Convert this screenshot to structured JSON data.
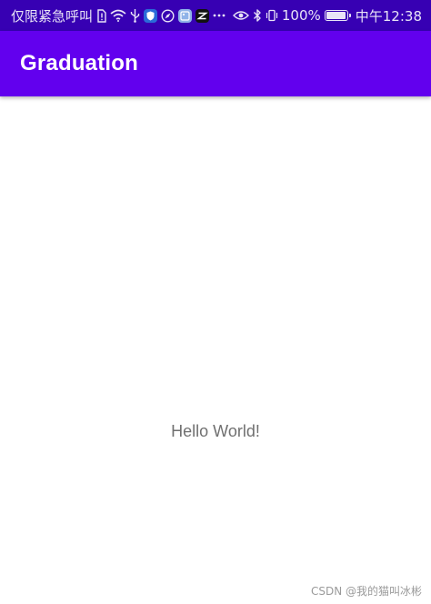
{
  "status_bar": {
    "carrier_text": "仅限紧急呼叫",
    "icons_left": [
      "sim-alert-icon",
      "wifi-icon",
      "usb-icon",
      "shield-app-icon",
      "browser-app-icon",
      "gallery-app-icon",
      "capcut-app-icon",
      "more-dots-icon"
    ],
    "battery_percent": "100%",
    "battery_level": 1.0,
    "time": "中午12:38",
    "colors": {
      "background": "#3700b3",
      "foreground": "#e9e4f7"
    }
  },
  "app_bar": {
    "title": "Graduation",
    "colors": {
      "background": "#6200ee",
      "title": "#ffffff"
    }
  },
  "main": {
    "hello_text": "Hello World!"
  },
  "watermark": {
    "text": "CSDN @我的猫叫冰彬"
  }
}
